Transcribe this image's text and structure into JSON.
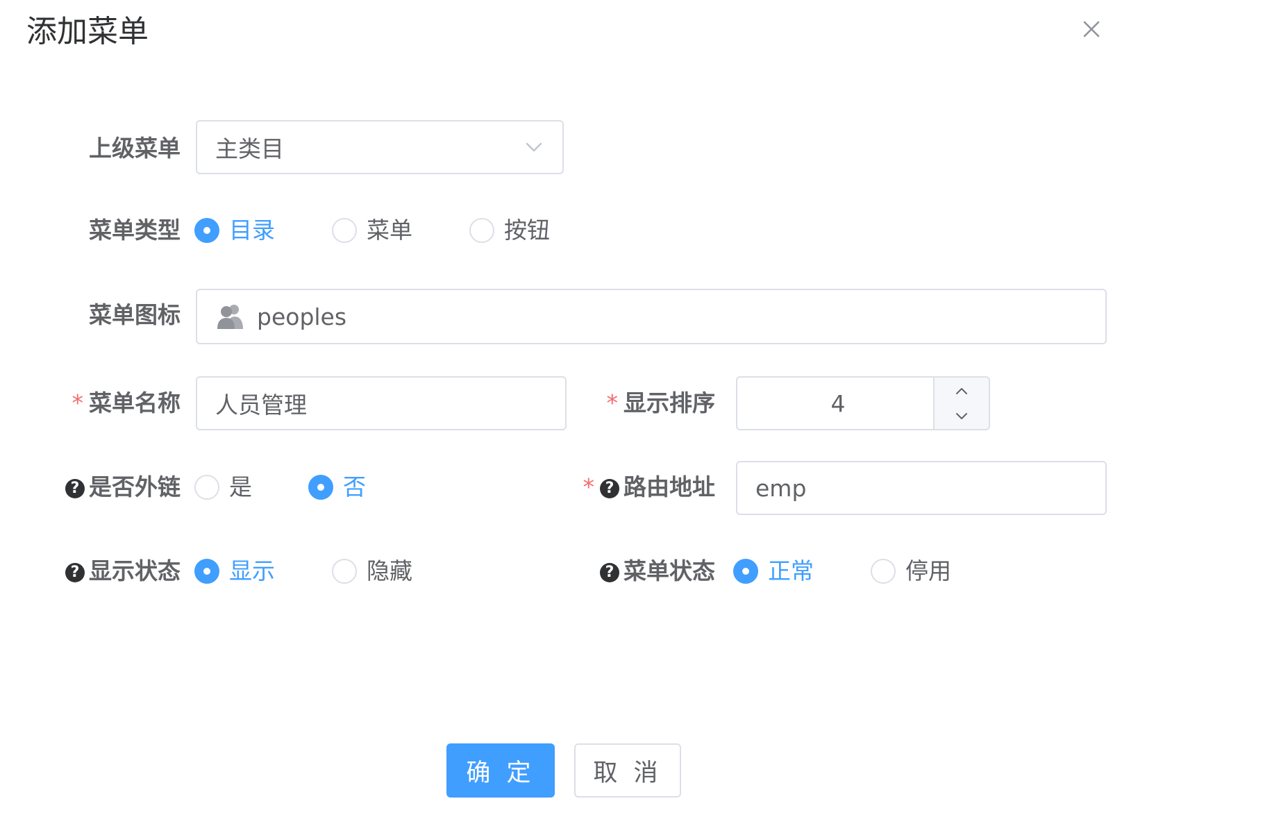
{
  "dialog": {
    "title": "添加菜单",
    "close_icon": "close-icon"
  },
  "form": {
    "parent_menu": {
      "label": "上级菜单",
      "value": "主类目",
      "icon": "chevron-down-icon"
    },
    "menu_type": {
      "label": "菜单类型",
      "options": [
        {
          "label": "目录",
          "checked": true
        },
        {
          "label": "菜单",
          "checked": false
        },
        {
          "label": "按钮",
          "checked": false
        }
      ]
    },
    "menu_icon": {
      "label": "菜单图标",
      "value": "peoples",
      "icon": "peoples-icon"
    },
    "menu_name": {
      "label": "菜单名称",
      "required": "*",
      "value": "人员管理"
    },
    "display_order": {
      "label": "显示排序",
      "required": "*",
      "value": "4"
    },
    "external_link": {
      "label": "是否外链",
      "help": "?",
      "options": [
        {
          "label": "是",
          "checked": false
        },
        {
          "label": "否",
          "checked": true
        }
      ]
    },
    "route_path": {
      "label": "路由地址",
      "required": "*",
      "help": "?",
      "value": "emp"
    },
    "display_status": {
      "label": "显示状态",
      "help": "?",
      "options": [
        {
          "label": "显示",
          "checked": true
        },
        {
          "label": "隐藏",
          "checked": false
        }
      ]
    },
    "menu_status": {
      "label": "菜单状态",
      "help": "?",
      "options": [
        {
          "label": "正常",
          "checked": true
        },
        {
          "label": "停用",
          "checked": false
        }
      ]
    }
  },
  "footer": {
    "confirm_label": "确 定",
    "cancel_label": "取 消"
  },
  "colors": {
    "primary": "#409eff",
    "border": "#dcdfe6",
    "text": "#606266",
    "required": "#f56c6c"
  }
}
